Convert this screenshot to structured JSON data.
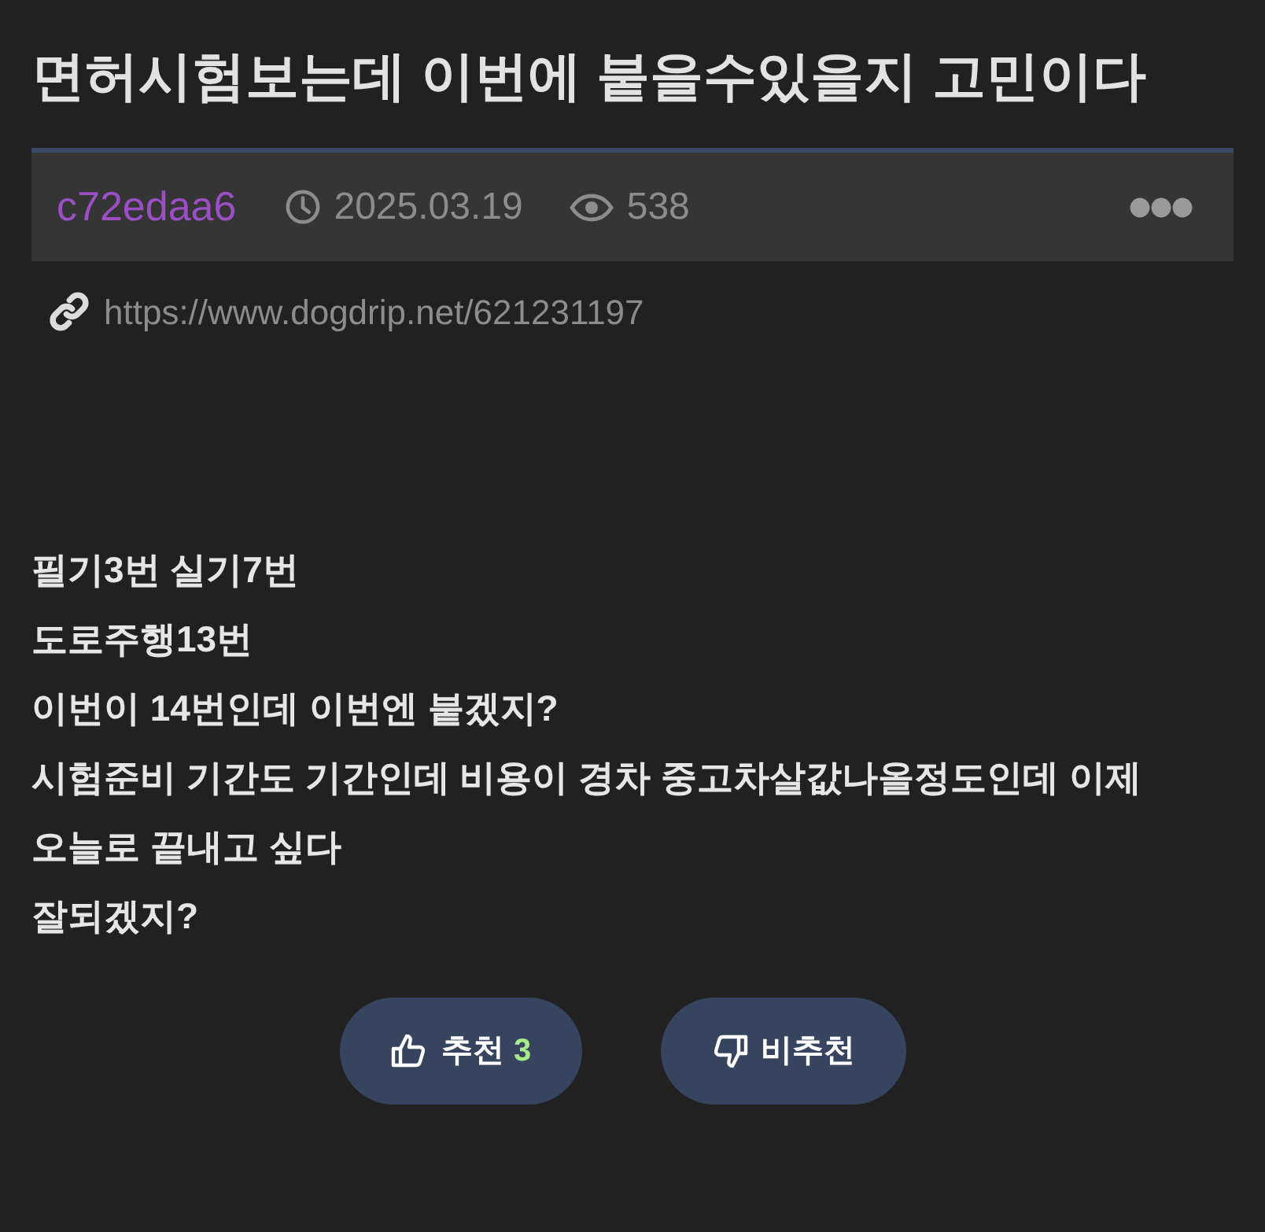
{
  "title": "면허시험보는데 이번에 붙을수있을지 고민이다",
  "meta": {
    "author": "c72edaa6",
    "date": "2025.03.19",
    "views": "538"
  },
  "link": "https://www.dogdrip.net/621231197",
  "body": [
    "필기3번 실기7번",
    "도로주행13번",
    "이번이 14번인데 이번엔 붙겠지?",
    "시험준비 기간도 기간인데 비용이 경차 중고차살값나올정도인데 이제",
    "오늘로 끝내고 싶다",
    "잘되겠지?"
  ],
  "votes": [
    {
      "kind": "up",
      "label": "추천",
      "count": "3"
    },
    {
      "kind": "down",
      "label": "비추천"
    }
  ]
}
